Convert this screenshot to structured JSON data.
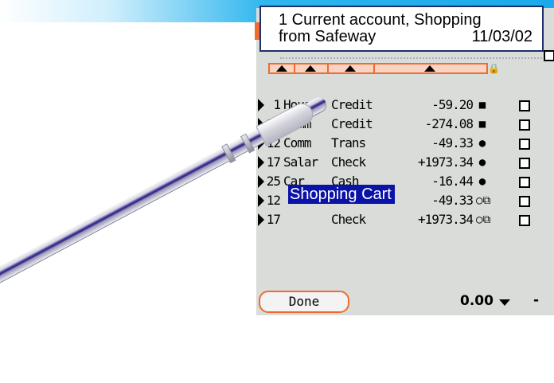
{
  "tooltip": {
    "line1": "1 Current account, Shopping",
    "line2": "from Safeway",
    "date": "11/03/02"
  },
  "highlight_text": "Shopping Cart",
  "transactions": [
    {
      "num": "1",
      "cat": "House",
      "type": "Credit",
      "amount": "-59.20",
      "flag": "■"
    },
    {
      "num": "10",
      "cat": "Comm",
      "type": "Credit",
      "amount": "-274.08",
      "flag": "■"
    },
    {
      "num": "12",
      "cat": "Comm",
      "type": "Trans",
      "amount": "-49.33",
      "flag": "●"
    },
    {
      "num": "17",
      "cat": "Salar",
      "type": "Check",
      "amount": "+1973.34",
      "flag": "●"
    },
    {
      "num": "25",
      "cat": "Car",
      "type": "Cash",
      "amount": "-16.44",
      "flag": "●"
    },
    {
      "num": "12",
      "cat": "",
      "type": "",
      "amount": "-49.33",
      "flag": "○⧉"
    },
    {
      "num": "17",
      "cat": "",
      "type": "Check",
      "amount": "+1973.34",
      "flag": "○⧉"
    }
  ],
  "footer": {
    "done_label": "Done",
    "balance": "0.00",
    "dash": "-"
  },
  "icons": {
    "sort": "triangle-up-icon",
    "lock": "lock-icon",
    "row_marker": "triangle-right-icon",
    "balance_menu": "chevron-down-icon"
  },
  "colors": {
    "highlight": "#0a12a8",
    "orange": "#ef6b32",
    "screen_bg": "#d9dcd9",
    "top_bar": "#1aa9ea"
  }
}
